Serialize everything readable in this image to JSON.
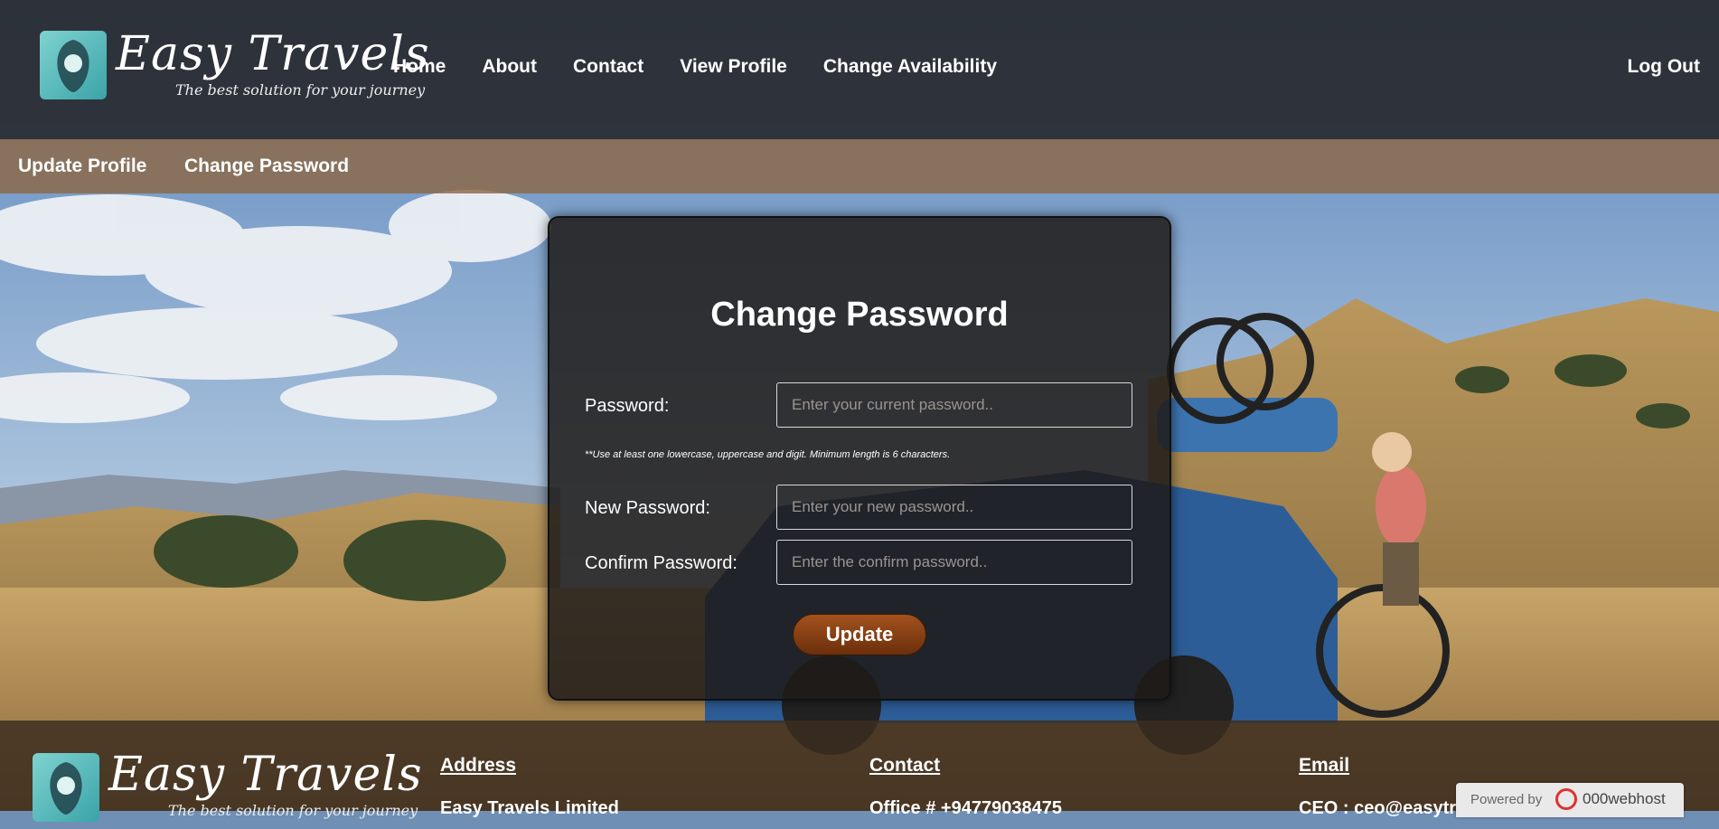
{
  "brand": {
    "title": "Easy Travels",
    "tagline": "The best solution for your journey"
  },
  "nav": {
    "items": [
      "Home",
      "About",
      "Contact",
      "View Profile",
      "Change Availability"
    ],
    "logout": "Log Out"
  },
  "subnav": {
    "items": [
      "Update Profile",
      "Change Password"
    ]
  },
  "form": {
    "title": "Change Password",
    "password_label": "Password:",
    "password_placeholder": "Enter your current password..",
    "hint": "**Use at least one lowercase, uppercase and digit. Minimum length is 6 characters.",
    "new_label": "New Password:",
    "new_placeholder": "Enter your new password..",
    "confirm_label": "Confirm Password:",
    "confirm_placeholder": "Enter the confirm password..",
    "submit_label": "Update"
  },
  "footer": {
    "address_heading": "Address",
    "address_value": "Easy Travels Limited",
    "contact_heading": "Contact",
    "contact_value": "Office # +94779038475",
    "email_heading": "Email",
    "email_value": "CEO : ceo@easytravels.com"
  },
  "badge": {
    "prefix": "Powered by",
    "host": "000webhost"
  },
  "colors": {
    "button": "#8a4116",
    "subbar": "#8c6946",
    "logo_badge": "#5cbcbf"
  }
}
